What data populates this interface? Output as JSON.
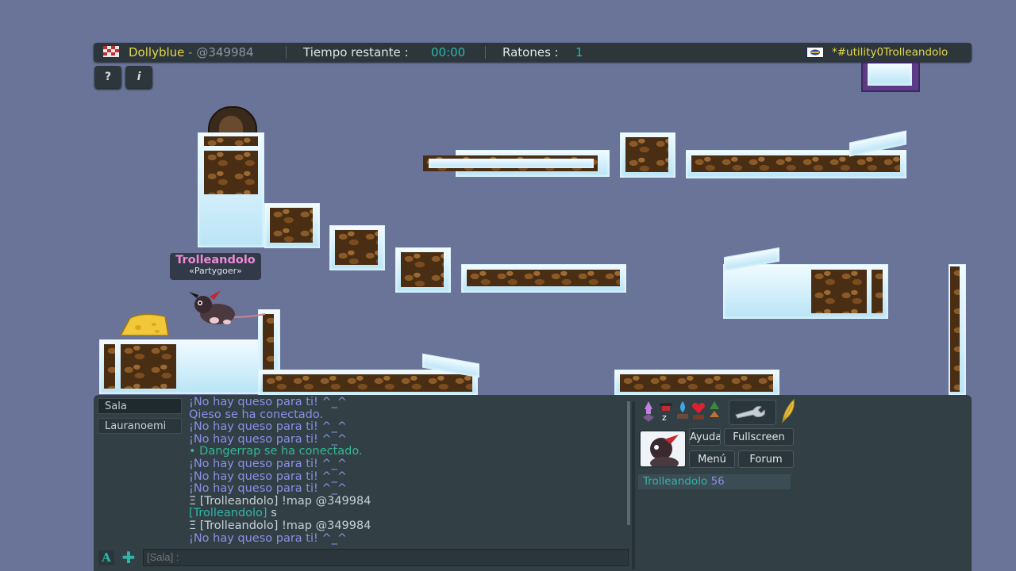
{
  "topbar": {
    "player": "Dollyblue",
    "dash": " - ",
    "map_code": "@349984",
    "time_label": "Tiempo restante :",
    "time_value": "00:00",
    "mice_label": "Ratones :",
    "mice_value": "1",
    "room_name": "*#utility0Trolleandolo"
  },
  "buttons": {
    "help": "?",
    "info": "i"
  },
  "player_tag": {
    "name": "Trolleandolo",
    "title": "«Partygoer»"
  },
  "chat": {
    "tabs": [
      "Sala",
      "Lauranoemi"
    ],
    "lines": [
      {
        "kind": "msg",
        "text": "¡No hay queso para ti! ^_^"
      },
      {
        "kind": "msg",
        "text": "Qieso se ha conectado."
      },
      {
        "kind": "msg",
        "text": "¡No hay queso para ti! ^_^"
      },
      {
        "kind": "msg",
        "text": "¡No hay queso para ti! ^_^"
      },
      {
        "kind": "sys",
        "text": "• Dangerrap se ha conectado."
      },
      {
        "kind": "msg",
        "text": "¡No hay queso para ti! ^_^"
      },
      {
        "kind": "msg",
        "text": "¡No hay queso para ti! ^_^"
      },
      {
        "kind": "msg",
        "text": "¡No hay queso para ti! ^_^"
      },
      {
        "kind": "cmd",
        "text": "Ξ [Trolleandolo] !map @349984"
      },
      {
        "kind": "name",
        "name": "[Trolleandolo]",
        "text": " s"
      },
      {
        "kind": "cmd",
        "text": "Ξ [Trolleandolo] !map @349984"
      },
      {
        "kind": "msg",
        "text": "¡No hay queso para ti! ^_^"
      }
    ],
    "input_placeholder": "[Sala] :",
    "font_button": "A",
    "add_button": "✚"
  },
  "menu": {
    "help": "Ayuda",
    "fullscreen": "Fullscreen",
    "menu": "Menú",
    "forum": "Forum"
  },
  "score": {
    "name": "Trolleandolo",
    "value": "56"
  },
  "icons": [
    "shaman-icon",
    "hat-icon",
    "water-drop-icon",
    "heart-icon",
    "tree-icon",
    "wrench-icon",
    "feather-icon"
  ],
  "colors": {
    "accent": "#2fb5a8",
    "player_name": "#e3d84a",
    "chat_message": "#8b8fe6",
    "system_message": "#36b596"
  }
}
